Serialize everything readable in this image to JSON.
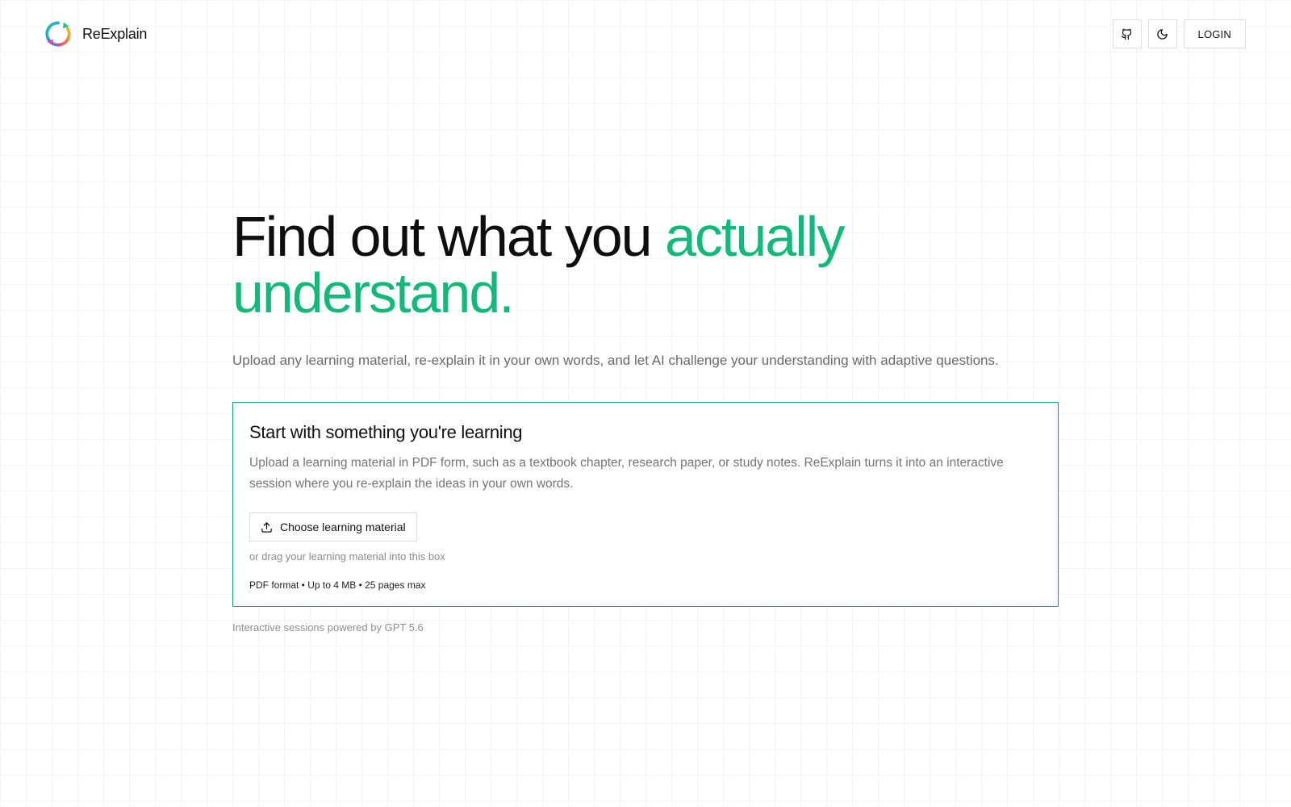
{
  "header": {
    "brand_name": "ReExplain",
    "logo_icon": "circular-arrows-gradient-icon",
    "github_icon": "github-icon",
    "theme_icon": "moon-icon",
    "login_label": "LOGIN"
  },
  "hero": {
    "headline_part1": "Find out what you ",
    "headline_accent1": "actually",
    "headline_accent2": "understand.",
    "subheadline": "Upload any learning material, re-explain it in your own words, and let AI challenge your understanding with adaptive questions."
  },
  "upload": {
    "title": "Start with something you're learning",
    "description": "Upload a learning material in PDF form, such as a textbook chapter, research paper, or study notes. ReExplain turns it into an interactive session where you re-explain the ideas in your own words.",
    "button_label": "Choose learning material",
    "button_icon": "upload-icon",
    "drag_hint": "or drag your learning material into this box",
    "limits": "PDF format • Up to 4 MB • 25 pages max"
  },
  "footer": {
    "powered_by": "Interactive sessions powered by GPT 5.6"
  },
  "colors": {
    "accent": "#14b87a",
    "card_border": "#12a677",
    "text_primary": "#111111",
    "text_muted": "#747474"
  }
}
